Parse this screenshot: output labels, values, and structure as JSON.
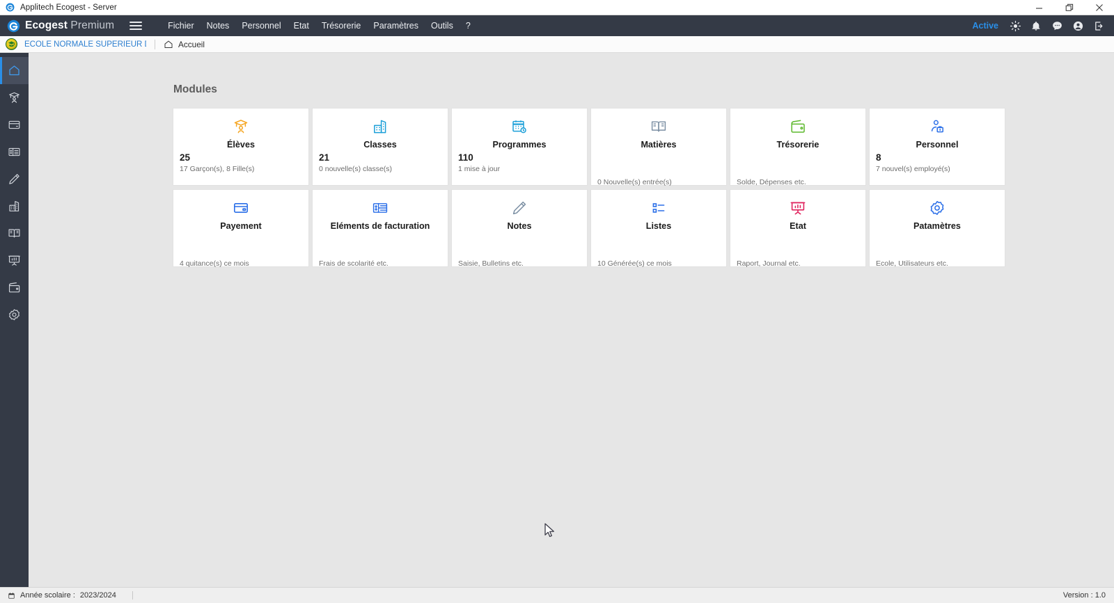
{
  "window": {
    "title": "Applitech Ecogest - Server",
    "controls": {
      "minimize": "minimize-icon",
      "restore": "restore-icon",
      "close": "close-icon"
    }
  },
  "appbar": {
    "brand_bold": "Ecogest",
    "brand_light": "Premium",
    "menu": [
      {
        "label": "Fichier",
        "name": "menu-fichier"
      },
      {
        "label": "Notes",
        "name": "menu-notes"
      },
      {
        "label": "Personnel",
        "name": "menu-personnel"
      },
      {
        "label": "Etat",
        "name": "menu-etat"
      },
      {
        "label": "Trésorerie",
        "name": "menu-tresorerie"
      },
      {
        "label": "Paramètres",
        "name": "menu-parametres"
      },
      {
        "label": "Outils",
        "name": "menu-outils"
      },
      {
        "label": "?",
        "name": "menu-help"
      }
    ],
    "status_label": "Active",
    "icons": [
      "brightness-icon",
      "bell-icon",
      "chat-icon",
      "account-icon",
      "logout-icon"
    ],
    "accent_color": "#2a8fe8"
  },
  "breadcrumb": {
    "school": "ECOLE NORMALE SUPERIEUR DE L...",
    "home_label": "Accueil"
  },
  "sidebar": {
    "items": [
      {
        "icon": "home-icon",
        "name": "sidebar-item-accueil",
        "active": true
      },
      {
        "icon": "graduation-cap-icon",
        "name": "sidebar-item-eleves",
        "active": false
      },
      {
        "icon": "credit-card-icon",
        "name": "sidebar-item-payement",
        "active": false
      },
      {
        "icon": "invoice-icon",
        "name": "sidebar-item-facturation",
        "active": false
      },
      {
        "icon": "pencil-icon",
        "name": "sidebar-item-notes",
        "active": false
      },
      {
        "icon": "building-icon",
        "name": "sidebar-item-classes",
        "active": false
      },
      {
        "icon": "book-icon",
        "name": "sidebar-item-matieres",
        "active": false
      },
      {
        "icon": "presentation-icon",
        "name": "sidebar-item-etat",
        "active": false
      },
      {
        "icon": "wallet-icon",
        "name": "sidebar-item-tresorerie",
        "active": false
      },
      {
        "icon": "gear-icon",
        "name": "sidebar-item-parametres",
        "active": false
      }
    ]
  },
  "main": {
    "section_title": "Modules",
    "cards": [
      {
        "name": "card-eleves",
        "icon": "graduation-cap-icon",
        "color": "#f5a623",
        "title": "Élèves",
        "count": "25",
        "sub": "17 Garçon(s), 8 Fille(s)"
      },
      {
        "name": "card-classes",
        "icon": "building-icon",
        "color": "#1b9fd8",
        "title": "Classes",
        "count": "21",
        "sub": "0 nouvelle(s) classe(s)"
      },
      {
        "name": "card-programmes",
        "icon": "calendar-clock-icon",
        "color": "#1b9fd8",
        "title": "Programmes",
        "count": "110",
        "sub": "1 mise à jour"
      },
      {
        "name": "card-matieres",
        "icon": "book-icon",
        "color": "#7b8fa3",
        "title": "Matières",
        "count": "",
        "sub": "0 Nouvelle(s) entrée(s)"
      },
      {
        "name": "card-tresorerie",
        "icon": "wallet-icon",
        "color": "#5cb82b",
        "title": "Trésorerie",
        "count": "",
        "sub": "Solde, Dépenses etc."
      },
      {
        "name": "card-personnel",
        "icon": "staff-icon",
        "color": "#2b6fe8",
        "title": "Personnel",
        "count": "8",
        "sub": "7 nouvel(s) employé(s)"
      },
      {
        "name": "card-payement",
        "icon": "credit-card-icon",
        "color": "#2b6fe8",
        "title": "Payement",
        "count": "",
        "sub": "4 quitance(s) ce mois"
      },
      {
        "name": "card-facturation",
        "icon": "invoice-icon",
        "color": "#2b6fe8",
        "title": "Eléments de facturation",
        "count": "",
        "sub": "Frais de scolarité etc."
      },
      {
        "name": "card-notes",
        "icon": "pencil-icon",
        "color": "#7b8fa3",
        "title": "Notes",
        "count": "",
        "sub": "Saisie, Bulletins etc."
      },
      {
        "name": "card-listes",
        "icon": "list-icon",
        "color": "#2b6fe8",
        "title": "Listes",
        "count": "",
        "sub": "10 Générée(s) ce mois"
      },
      {
        "name": "card-etat",
        "icon": "presentation-icon",
        "color": "#e0245e",
        "title": "Etat",
        "count": "",
        "sub": "Raport, Journal etc."
      },
      {
        "name": "card-parametres",
        "icon": "gear-icon",
        "color": "#2b6fe8",
        "title": "Patamètres",
        "count": "",
        "sub": "Ecole, Utilisateurs etc."
      }
    ]
  },
  "statusbar": {
    "school_year_label": "Année scolaire :",
    "school_year_value": "2023/2024",
    "version": "Version : 1.0"
  }
}
